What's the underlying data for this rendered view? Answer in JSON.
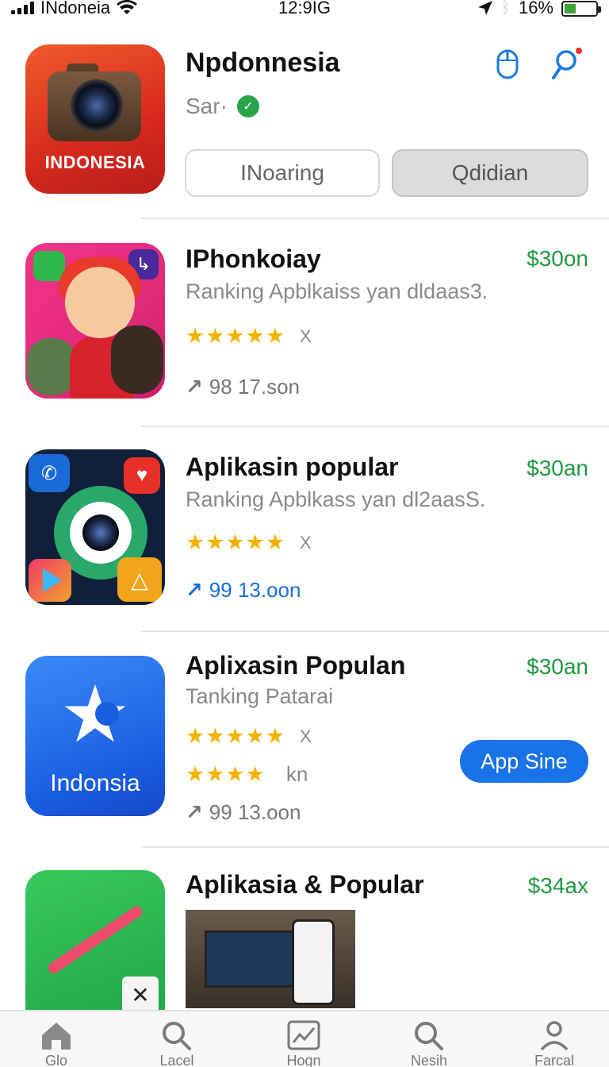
{
  "status_bar": {
    "carrier": "INdoneia",
    "time": "12:9IG",
    "battery": "16%"
  },
  "header": {
    "title": "Npdonnesia",
    "subtitle": "Sar·",
    "icon_label": "INDONESIA",
    "segments": [
      "INoaring",
      "Qdidian"
    ]
  },
  "apps": [
    {
      "title": "IPhonkoiay",
      "price": "$30on",
      "desc": "Ranking Apblkaiss yan dldaas3.",
      "stars": "★★★★★",
      "star_tail": "X",
      "stat": "98 17.son"
    },
    {
      "title": "Aplikasin popular",
      "price": "$30an",
      "desc": "Ranking Apblkass yan dl2aasS.",
      "stars": "★★★★★",
      "star_tail": "X",
      "stat": "99 13.oon"
    },
    {
      "title": "Aplixasin Populan",
      "price": "$30an",
      "desc": "Tanking Patarai",
      "stars": "★★★★★",
      "star_tail": "X",
      "stars2": "★★★★",
      "star_tail2": "kn",
      "stat": "99 13.oon",
      "icon_label": "Indonsia",
      "button": "App Sine"
    },
    {
      "title": "Aplikasia & Popular",
      "price": "$34ax"
    }
  ],
  "tabs": [
    "Glo",
    "Lacel",
    "Hogn",
    "Nesih",
    "Farcal"
  ],
  "colors": {
    "accent": "#1a72e8",
    "price": "#1f9a3f",
    "star": "#f3b200"
  }
}
